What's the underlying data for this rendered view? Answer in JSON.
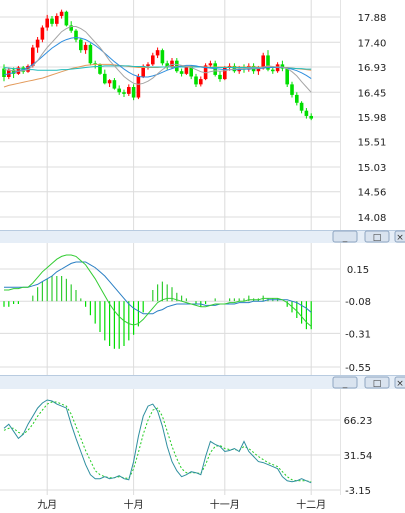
{
  "colors": {
    "up": "#ff0000",
    "down": "#00dd00",
    "ma_short": "#a5a5a5",
    "ma_mid": "#2f8fdf",
    "ma_long": "#e39a5a",
    "ma_long2": "#22bcbc",
    "macd_dif": "#33cc33",
    "macd_dea": "#2a7fc4",
    "kd_k": "#2f8f9f",
    "kd_d": "#22cc22",
    "grid": "#dcdcdc",
    "divider": "#b8cbe0"
  },
  "window_buttons": {
    "minimize": "_",
    "restore": "□",
    "close": "×"
  },
  "chart_data": [
    {
      "type": "candlestick",
      "name_hint": "price",
      "yticks": [
        "17.88",
        "17.40",
        "16.93",
        "16.45",
        "15.98",
        "15.51",
        "15.03",
        "14.56",
        "14.08"
      ],
      "ylim": [
        14.08,
        17.88
      ],
      "xticks": [
        "九月",
        "十月",
        "十一月",
        "十二月"
      ],
      "xtick_index": [
        9,
        27,
        46,
        64
      ],
      "candles": [
        [
          16.9,
          16.98,
          16.66,
          16.74
        ],
        [
          16.74,
          16.92,
          16.7,
          16.88
        ],
        [
          16.88,
          16.92,
          16.72,
          16.8
        ],
        [
          16.8,
          16.95,
          16.78,
          16.92
        ],
        [
          16.92,
          16.95,
          16.8,
          16.84
        ],
        [
          16.84,
          16.98,
          16.82,
          16.95
        ],
        [
          16.95,
          17.35,
          16.92,
          17.3
        ],
        [
          17.3,
          17.5,
          17.2,
          17.45
        ],
        [
          17.45,
          17.72,
          17.4,
          17.68
        ],
        [
          17.68,
          17.92,
          17.62,
          17.85
        ],
        [
          17.85,
          17.9,
          17.7,
          17.75
        ],
        [
          17.75,
          17.95,
          17.7,
          17.9
        ],
        [
          17.9,
          18.02,
          17.85,
          17.98
        ],
        [
          17.98,
          18.0,
          17.7,
          17.72
        ],
        [
          17.72,
          17.8,
          17.58,
          17.62
        ],
        [
          17.62,
          17.65,
          17.4,
          17.45
        ],
        [
          17.45,
          17.48,
          17.2,
          17.25
        ],
        [
          17.25,
          17.4,
          17.18,
          17.35
        ],
        [
          17.35,
          17.38,
          16.96,
          17.0
        ],
        [
          17.0,
          17.05,
          16.9,
          16.98
        ],
        [
          16.98,
          17.0,
          16.78,
          16.8
        ],
        [
          16.8,
          16.88,
          16.6,
          16.62
        ],
        [
          16.62,
          16.7,
          16.55,
          16.68
        ],
        [
          16.68,
          16.72,
          16.5,
          16.52
        ],
        [
          16.52,
          16.58,
          16.4,
          16.45
        ],
        [
          16.45,
          16.5,
          16.36,
          16.42
        ],
        [
          16.42,
          16.6,
          16.38,
          16.55
        ],
        [
          16.55,
          16.6,
          16.3,
          16.35
        ],
        [
          16.35,
          16.8,
          16.32,
          16.75
        ],
        [
          16.75,
          16.98,
          16.72,
          16.95
        ],
        [
          16.95,
          17.02,
          16.88,
          16.98
        ],
        [
          16.98,
          17.2,
          16.95,
          17.15
        ],
        [
          17.15,
          17.3,
          17.1,
          17.25
        ],
        [
          17.25,
          17.28,
          16.96,
          17.0
        ],
        [
          17.0,
          17.05,
          16.88,
          16.92
        ],
        [
          16.92,
          17.1,
          16.9,
          17.05
        ],
        [
          17.05,
          17.1,
          16.82,
          16.85
        ],
        [
          16.85,
          16.9,
          16.75,
          16.8
        ],
        [
          16.8,
          16.95,
          16.78,
          16.92
        ],
        [
          16.92,
          16.96,
          16.7,
          16.75
        ],
        [
          16.75,
          16.8,
          16.55,
          16.6
        ],
        [
          16.6,
          16.75,
          16.56,
          16.7
        ],
        [
          16.7,
          17.0,
          16.68,
          16.96
        ],
        [
          16.96,
          17.05,
          16.92,
          17.0
        ],
        [
          17.0,
          17.05,
          16.75,
          16.78
        ],
        [
          16.78,
          16.85,
          16.65,
          16.7
        ],
        [
          16.7,
          16.95,
          16.68,
          16.92
        ],
        [
          16.92,
          17.0,
          16.86,
          16.95
        ],
        [
          16.95,
          17.0,
          16.82,
          16.85
        ],
        [
          16.85,
          16.95,
          16.8,
          16.9
        ],
        [
          16.9,
          16.98,
          16.82,
          16.88
        ],
        [
          16.88,
          17.0,
          16.84,
          16.95
        ],
        [
          16.95,
          17.0,
          16.8,
          16.85
        ],
        [
          16.85,
          16.95,
          16.78,
          16.9
        ],
        [
          16.9,
          17.2,
          16.88,
          17.15
        ],
        [
          17.15,
          17.25,
          16.85,
          16.88
        ],
        [
          16.88,
          16.92,
          16.8,
          16.85
        ],
        [
          16.85,
          17.02,
          16.82,
          16.98
        ],
        [
          16.98,
          17.05,
          16.85,
          16.9
        ],
        [
          16.9,
          16.92,
          16.55,
          16.6
        ],
        [
          16.6,
          16.65,
          16.35,
          16.4
        ],
        [
          16.4,
          16.45,
          16.2,
          16.25
        ],
        [
          16.25,
          16.28,
          16.05,
          16.1
        ],
        [
          16.1,
          16.15,
          15.95,
          16.0
        ],
        [
          16.0,
          16.05,
          15.92,
          15.95
        ]
      ],
      "ma_short": [
        16.88,
        16.87,
        16.86,
        16.85,
        16.86,
        16.88,
        16.95,
        17.05,
        17.18,
        17.3,
        17.4,
        17.5,
        17.6,
        17.66,
        17.7,
        17.7,
        17.66,
        17.6,
        17.5,
        17.4,
        17.3,
        17.18,
        17.05,
        16.95,
        16.85,
        16.75,
        16.68,
        16.62,
        16.6,
        16.62,
        16.66,
        16.72,
        16.8,
        16.88,
        16.94,
        16.98,
        16.98,
        16.96,
        16.94,
        16.92,
        16.88,
        16.84,
        16.82,
        16.84,
        16.86,
        16.85,
        16.86,
        16.88,
        16.89,
        16.9,
        16.9,
        16.91,
        16.91,
        16.91,
        16.93,
        16.95,
        16.94,
        16.93,
        16.93,
        16.9,
        16.84,
        16.76,
        16.65,
        16.55,
        16.45
      ],
      "ma_mid": [
        16.78,
        16.8,
        16.82,
        16.85,
        16.88,
        16.92,
        16.98,
        17.05,
        17.13,
        17.21,
        17.29,
        17.35,
        17.41,
        17.45,
        17.48,
        17.49,
        17.48,
        17.45,
        17.4,
        17.34,
        17.27,
        17.19,
        17.11,
        17.03,
        16.96,
        16.89,
        16.83,
        16.78,
        16.75,
        16.74,
        16.74,
        16.76,
        16.79,
        16.83,
        16.87,
        16.9,
        16.93,
        16.95,
        16.96,
        16.96,
        16.95,
        16.93,
        16.92,
        16.91,
        16.9,
        16.89,
        16.88,
        16.88,
        16.88,
        16.88,
        16.89,
        16.89,
        16.9,
        16.9,
        16.91,
        16.92,
        16.92,
        16.92,
        16.92,
        16.91,
        16.89,
        16.86,
        16.82,
        16.77,
        16.71
      ],
      "ma_long": [
        16.55,
        16.58,
        16.6,
        16.62,
        16.64,
        16.66,
        16.68,
        16.7,
        16.72,
        16.75,
        16.78,
        16.81,
        16.84,
        16.87,
        16.9,
        16.92,
        16.94,
        16.96,
        16.97,
        16.98,
        16.98,
        16.98,
        16.98,
        16.97,
        16.96,
        16.95,
        16.94,
        16.93,
        16.92,
        16.92,
        16.92,
        16.92,
        16.92,
        16.93,
        16.93,
        16.94,
        16.94,
        16.94,
        16.94,
        16.94,
        16.94,
        16.94,
        16.93,
        16.93,
        16.93,
        16.93,
        16.93,
        16.93,
        16.93,
        16.93,
        16.93,
        16.93,
        16.93,
        16.93,
        16.93,
        16.93,
        16.93,
        16.93,
        16.92,
        16.92,
        16.91,
        16.9,
        16.89,
        16.88,
        16.87
      ],
      "ma_long2": [
        16.92,
        16.91,
        16.9,
        16.9,
        16.89,
        16.88,
        16.88,
        16.87,
        16.87,
        16.87,
        16.87,
        16.87,
        16.88,
        16.88,
        16.89,
        16.9,
        16.91,
        16.92,
        16.93,
        16.94,
        16.94,
        16.95,
        16.95,
        16.95,
        16.95,
        16.95,
        16.95,
        16.94,
        16.94,
        16.94,
        16.93,
        16.93,
        16.93,
        16.93,
        16.93,
        16.93,
        16.93,
        16.93,
        16.93,
        16.93,
        16.93,
        16.93,
        16.92,
        16.92,
        16.92,
        16.92,
        16.92,
        16.92,
        16.92,
        16.92,
        16.92,
        16.92,
        16.92,
        16.92,
        16.92,
        16.92,
        16.92,
        16.92,
        16.92,
        16.91,
        16.91,
        16.9,
        16.9,
        16.89,
        16.89
      ]
    },
    {
      "type": "macd",
      "yticks": [
        "0.15",
        "-0.08",
        "-0.31",
        "-0.55"
      ],
      "ylim": [
        -0.55,
        0.15
      ],
      "dif": [
        0.0,
        0.0,
        0.01,
        0.01,
        0.02,
        0.02,
        0.05,
        0.09,
        0.13,
        0.16,
        0.19,
        0.22,
        0.24,
        0.25,
        0.25,
        0.24,
        0.21,
        0.18,
        0.13,
        0.08,
        0.02,
        -0.04,
        -0.1,
        -0.15,
        -0.19,
        -0.22,
        -0.24,
        -0.25,
        -0.24,
        -0.21,
        -0.17,
        -0.13,
        -0.09,
        -0.07,
        -0.06,
        -0.06,
        -0.07,
        -0.08,
        -0.09,
        -0.1,
        -0.11,
        -0.12,
        -0.12,
        -0.11,
        -0.1,
        -0.1,
        -0.1,
        -0.09,
        -0.09,
        -0.08,
        -0.08,
        -0.07,
        -0.07,
        -0.07,
        -0.06,
        -0.06,
        -0.06,
        -0.06,
        -0.07,
        -0.09,
        -0.12,
        -0.15,
        -0.19,
        -0.23,
        -0.26
      ],
      "dea": [
        0.02,
        0.02,
        0.02,
        0.02,
        0.02,
        0.02,
        0.03,
        0.04,
        0.06,
        0.08,
        0.1,
        0.13,
        0.15,
        0.17,
        0.19,
        0.2,
        0.2,
        0.2,
        0.18,
        0.16,
        0.13,
        0.1,
        0.06,
        0.02,
        -0.02,
        -0.06,
        -0.1,
        -0.13,
        -0.15,
        -0.17,
        -0.17,
        -0.17,
        -0.15,
        -0.14,
        -0.12,
        -0.11,
        -0.1,
        -0.1,
        -0.1,
        -0.1,
        -0.1,
        -0.1,
        -0.11,
        -0.11,
        -0.11,
        -0.1,
        -0.1,
        -0.1,
        -0.1,
        -0.09,
        -0.09,
        -0.09,
        -0.08,
        -0.08,
        -0.08,
        -0.07,
        -0.07,
        -0.07,
        -0.07,
        -0.07,
        -0.08,
        -0.09,
        -0.11,
        -0.13,
        -0.16
      ],
      "bar_note": "histogram = 2 × (dif − dea)"
    },
    {
      "type": "kd",
      "yticks": [
        "66.23",
        "31.54",
        "-3.15"
      ],
      "ylim": [
        -3.15,
        88
      ],
      "k": [
        58,
        62,
        55,
        48,
        52,
        62,
        70,
        78,
        83,
        86,
        85,
        82,
        80,
        78,
        62,
        48,
        35,
        22,
        12,
        8,
        8,
        10,
        8,
        9,
        11,
        8,
        7,
        25,
        50,
        70,
        80,
        82,
        75,
        60,
        40,
        25,
        16,
        10,
        12,
        15,
        14,
        12,
        30,
        45,
        42,
        40,
        35,
        36,
        38,
        35,
        45,
        35,
        30,
        25,
        24,
        22,
        20,
        18,
        10,
        6,
        5,
        6,
        8,
        6,
        4
      ],
      "d": [
        56,
        58,
        58,
        54,
        52,
        56,
        62,
        70,
        76,
        82,
        84,
        84,
        82,
        80,
        72,
        60,
        48,
        36,
        26,
        16,
        12,
        10,
        9,
        9,
        10,
        9,
        8,
        18,
        34,
        52,
        66,
        76,
        78,
        70,
        55,
        40,
        28,
        18,
        14,
        14,
        14,
        13,
        22,
        34,
        40,
        41,
        38,
        37,
        37,
        36,
        40,
        38,
        34,
        30,
        27,
        24,
        22,
        20,
        15,
        10,
        7,
        6,
        6,
        6,
        5
      ]
    }
  ]
}
